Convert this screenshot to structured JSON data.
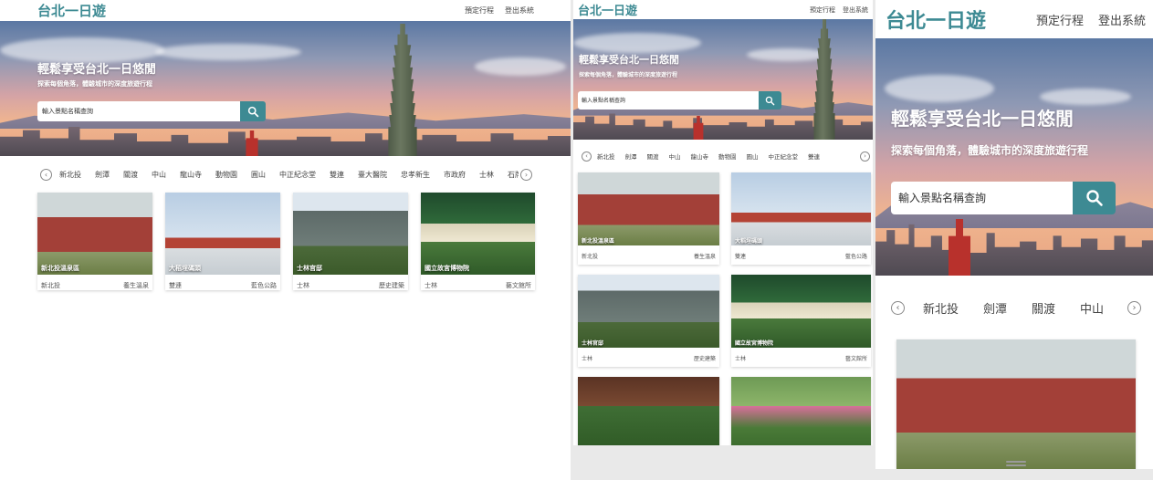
{
  "header": {
    "logo": "台北一日遊",
    "nav": [
      "預定行程",
      "登出系統"
    ]
  },
  "hero": {
    "title": "輕鬆享受台北一日悠閒",
    "subtitle": "探索每個角落，體驗城市的深度旅遊行程",
    "search_placeholder": "輸入景點名稱查詢"
  },
  "categories": [
    "新北投",
    "劍潭",
    "關渡",
    "中山",
    "龍山寺",
    "動物園",
    "圓山",
    "中正紀念堂",
    "雙連",
    "臺大醫院",
    "忠孝新生",
    "市政府",
    "士林",
    "石牌"
  ],
  "categories_p2": [
    "新北投",
    "劍潭",
    "關渡",
    "中山",
    "龍山寺",
    "動物園",
    "圓山",
    "中正紀念堂",
    "雙連"
  ],
  "categories_p3": [
    "新北投",
    "劍潭",
    "關渡",
    "中山"
  ],
  "attractions": [
    {
      "name": "新北投溫泉區",
      "mrt": "新北投",
      "category": "養生溫泉"
    },
    {
      "name": "大稻埕碼頭",
      "mrt": "雙連",
      "category": "藍色公路"
    },
    {
      "name": "士林官邸",
      "mrt": "士林",
      "category": "歷史建築"
    },
    {
      "name": "國立故宮博物院",
      "mrt": "士林",
      "category": "藝文館所"
    }
  ],
  "icons": {
    "search": "search-icon",
    "prev": "chevron-left-icon",
    "next": "chevron-right-icon"
  },
  "colors": {
    "accent": "#3d8a93"
  }
}
